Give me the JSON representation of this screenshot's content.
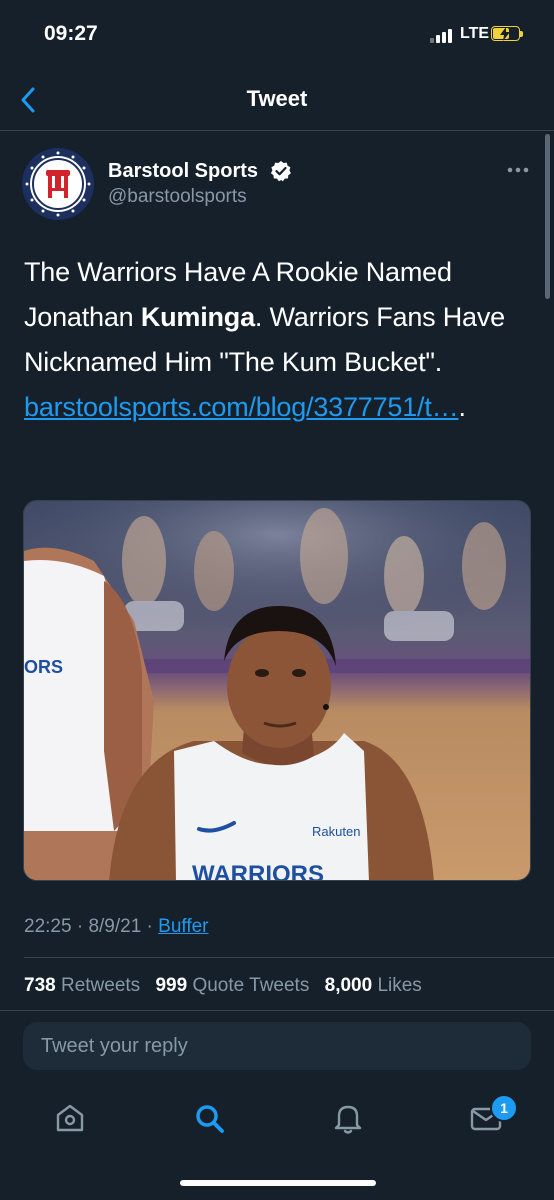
{
  "status": {
    "time": "09:27",
    "network": "LTE"
  },
  "header": {
    "title": "Tweet"
  },
  "tweet": {
    "author_name": "Barstool Sports",
    "author_handle": "@barstoolsports",
    "text_part1": "The Warriors Have A Rookie Named Jonathan ",
    "text_bold": "Kuminga",
    "text_part2": ". Warriors Fans Have Nicknamed Him \"The Kum Bucket\". ",
    "link_text": "barstoolsports.com/blog/3377751/t…",
    "text_end": ".",
    "jersey_text": "WARRIORS",
    "jersey_left_text": "ORS",
    "sponsor_text": "Rakuten",
    "time": "22:25",
    "date": "8/9/21",
    "source": "Buffer",
    "separator": "·"
  },
  "stats": {
    "retweets_count": "738",
    "retweets_label": "Retweets",
    "quotes_count": "999",
    "quotes_label": "Quote Tweets",
    "likes_count": "8,000",
    "likes_label": "Likes"
  },
  "reply": {
    "placeholder": "Tweet your reply"
  },
  "tabs": {
    "notifications_badge": "1"
  },
  "colors": {
    "background": "#15202b",
    "accent": "#1d9bf0",
    "secondary_text": "#8899a6",
    "divider": "#38444d",
    "battery": "#f0d23a"
  },
  "icons": [
    "back-arrow-icon",
    "verified-icon",
    "more-icon",
    "home-icon",
    "search-icon",
    "bell-icon",
    "mail-icon"
  ]
}
